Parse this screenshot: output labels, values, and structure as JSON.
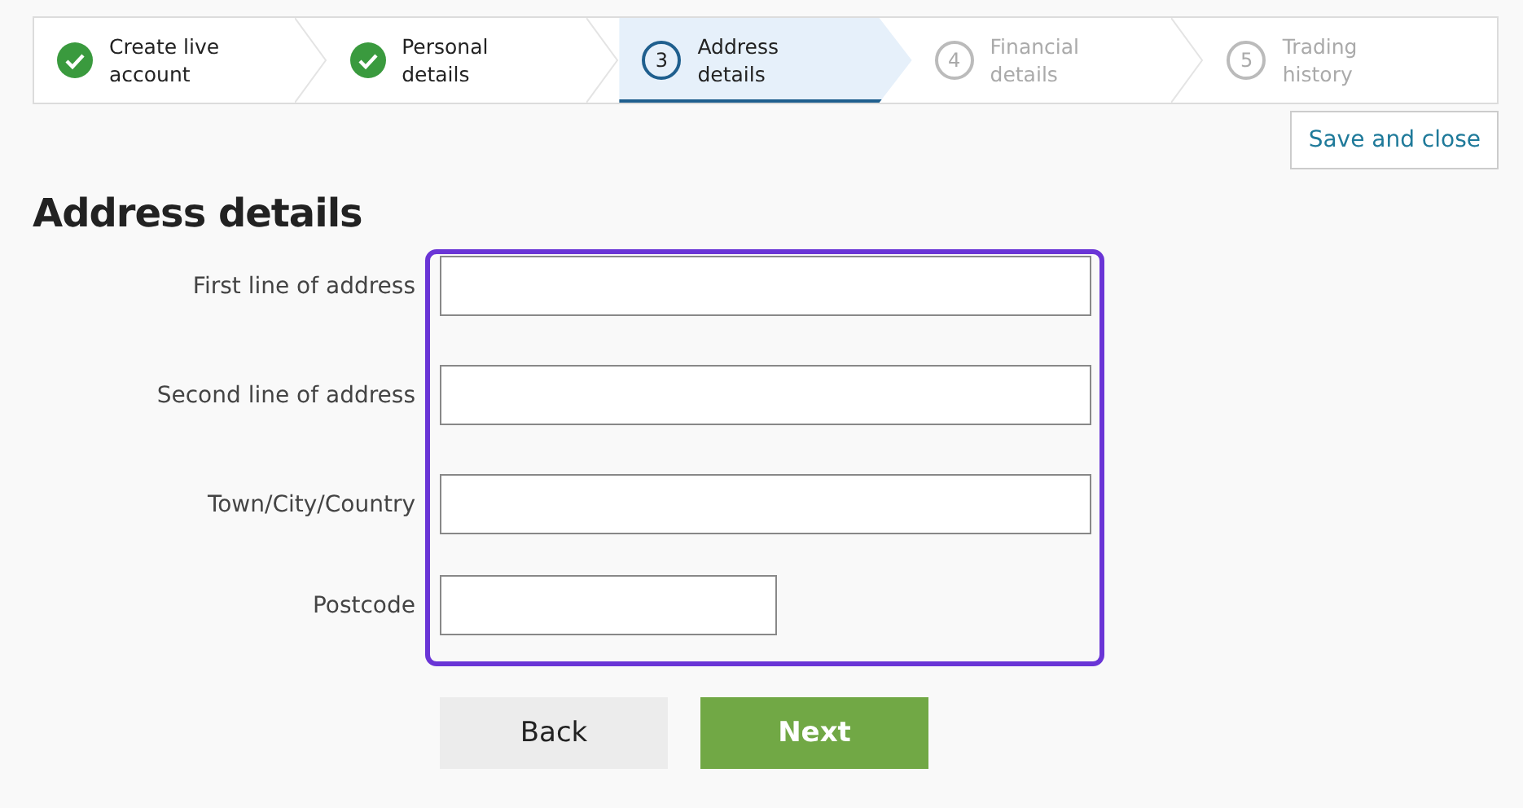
{
  "steps": [
    {
      "kind": "done",
      "label_lines": [
        "Create live",
        "account"
      ]
    },
    {
      "kind": "done",
      "label_lines": [
        "Personal",
        "details"
      ]
    },
    {
      "kind": "current",
      "number": "3",
      "label_lines": [
        "Address",
        "details"
      ]
    },
    {
      "kind": "upcoming",
      "number": "4",
      "label_lines": [
        "Financial",
        "details"
      ]
    },
    {
      "kind": "upcoming",
      "number": "5",
      "label_lines": [
        "Trading",
        "history"
      ]
    }
  ],
  "save_button": "Save and close",
  "heading": "Address details",
  "fields": [
    {
      "label": "First line of address",
      "kind": "wide"
    },
    {
      "label": "Second line of address",
      "kind": "wide"
    },
    {
      "label": "Town/City/Country",
      "kind": "wide"
    },
    {
      "label": "Postcode",
      "kind": "short"
    }
  ],
  "buttons": [
    {
      "label": "Back",
      "kind": "secondary"
    },
    {
      "label": "Next",
      "kind": "primary"
    }
  ]
}
